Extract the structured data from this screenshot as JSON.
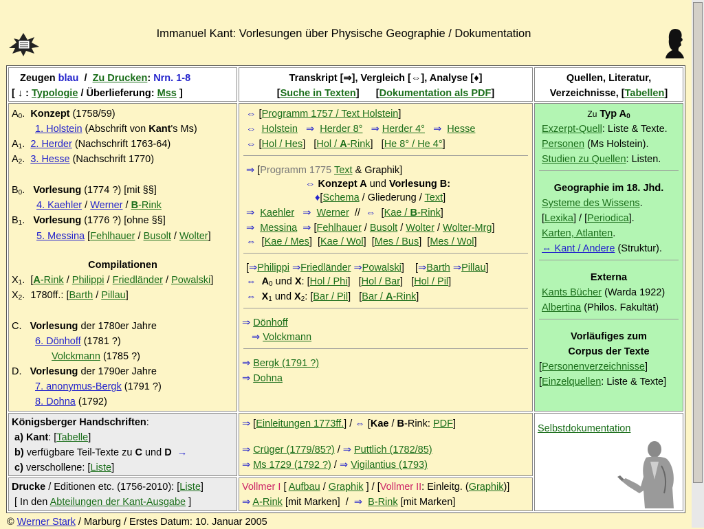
{
  "page_title": "Immanuel Kant: Vorlesungen über Physische Geographie / Dokumentation",
  "hdr": {
    "zeugen": "Zeugen",
    "blau": "blau",
    "slash": "/",
    "zu_drucken": "Zu Drucken",
    "nrn": "Nrn. 1-8",
    "typologie_pre": "[ ↓ :",
    "typologie": "Typologie",
    "ueberl": "/  Überlieferung:",
    "mss": "Mss",
    "close": "]",
    "trans_title": "Transkript [⇒], Vergleich [⇔], Analyse [♦]",
    "suche": "Suche in Texten",
    "doku_pdf": "Dokumentation als PDF",
    "quellen_title": "Quellen, Literatur,",
    "verz": "Verzeichnisse, [",
    "tabellen": "Tabellen",
    "close2": "]"
  },
  "left": {
    "a0_label": "A",
    "a0_sub": "0",
    "a0_b": "Konzept",
    "a0_t": "(1758/59)",
    "holstein": "1. Holstein",
    "holstein_t": "(Abschrift von",
    "kant": "Kant",
    "holstein_t2": "'s Ms)",
    "a1_label": "A",
    "a1_sub": "1",
    "herder": "2. Herder",
    "herder_t": "(Nachschrift 1763-64)",
    "a2_label": "A",
    "a2_sub": "2",
    "hesse": "3. Hesse",
    "hesse_t": "(Nachschrift 1770)",
    "b0_label": "B",
    "b0_sub": "0",
    "b0_b": "Vorlesung",
    "b0_t": "(1774 ?) [mit §§]",
    "kaehler": "4. Kaehler",
    "werner": "Werner",
    "brink": "B",
    "brink2": "-Rink",
    "b1_label": "B",
    "b1_sub": "1",
    "b1_b": "Vorlesung",
    "b1_t": "(1776 ?) [ohne §§]",
    "messina": "5. Messina",
    "fehlhauer": "Fehlhauer",
    "busolt": "Busolt",
    "wolter": "Wolter",
    "comp": "Compilationen",
    "x1_label": "X",
    "x1_sub": "1",
    "arink_a": "A",
    "arink": "-Rink",
    "philippi": "Philippi",
    "friedlaender": "Friedländer",
    "powalski": "Powalski",
    "x2_label": "X",
    "x2_sub": "2",
    "x2_t": "1780ff.:",
    "barth": "Barth",
    "pillau": "Pillau",
    "c_label": "C.",
    "c_b": "Vorlesung",
    "c_t": "der 1780er Jahre",
    "doenhoff": "6. Dönhoff",
    "doenhoff_t": "(1781 ?)",
    "volckmann": "Volckmann",
    "volckmann_t": "(1785 ?)",
    "d_label": "D.",
    "d_b": "Vorlesung",
    "d_t": "der 1790er Jahre",
    "bergk": "7. anonymus-Bergk",
    "bergk_t": "(1791 ?)",
    "dohna": "8. Dohna",
    "dohna_t": "(1792)"
  },
  "mid": {
    "prog1757": "Programm 1757 / Text Holstein",
    "holstein": "Holstein",
    "herder8": "Herder 8°",
    "herder4": "Herder 4°",
    "hesse": "Hesse",
    "holhes": "Hol / Hes",
    "hol_a": "Hol / ",
    "hol_a2": "A",
    "hol_a3": "-Rink",
    "he": "He  8° / He  4°",
    "prog1775": "Programm 1775",
    "text": "Text",
    "graphik_t": "& Graphik]",
    "konzept": "Konzept A",
    "und": "und",
    "vorlesung": "Vorlesung B:",
    "schema": "Schema",
    "gliederung": "/ Gliederung /",
    "text2": "Text",
    "kaehler": "Kaehler",
    "werner": "Werner",
    "kae_b": "Kae / ",
    "kae_b2": "B",
    "kae_b3": "-Rink",
    "messina": "Messina",
    "fehlhauer": "Fehlhauer",
    "busolt": "Busolt",
    "wolter": "Wolter",
    "wolter_mrg": "Wolter-Mrg",
    "kae_mes": "Kae / Mes",
    "kae_wol": "Kae / Wol",
    "mes_bus": "Mes / Bus",
    "mes_wol": "Mes / Wol",
    "philippi": "Philippi",
    "friedlaender": "Friedländer",
    "powalski": "Powalski",
    "barth": "Barth",
    "pillau": "Pillau",
    "a0x": "A",
    "a0x_sub": "0",
    "a0x_t": "und",
    "a0x_x": "X",
    "hol_phi": "Hol / Phi",
    "hol_bar": "Hol / Bar",
    "hol_pil": "Hol / Pil",
    "x1": "X",
    "x1_sub": "1",
    "x2": "X",
    "x2_sub": "2",
    "bar_pil": "Bar / Pil",
    "bar_a": "Bar / ",
    "bar_a2": "A",
    "bar_a3": "-Rink",
    "doenhoff": "Dönhoff",
    "volckmann": "Volckmann",
    "bergk": "Bergk (1791 ?)",
    "dohna": "Dohna",
    "einl": "Einleitungen 1773ff.",
    "kae": "Kae",
    "brink_b": "B",
    "brink_t": "-Rink:",
    "pdf": "PDF",
    "cruger": "Crüger (1779/85?)",
    "puttlich": "Puttlich (1782/85)",
    "ms1729": "Ms 1729 (1792 ?)",
    "vigilantius": "Vigilantius (1793)",
    "vollmer1": "Vollmer I",
    "aufbau": "Aufbau",
    "graphik": "Graphik",
    "vollmer2": "Vollmer II",
    "einleitg": "Einleitg. (",
    "graphik2": "Graphik",
    "arink_a": "A",
    "arink": "-Rink",
    "marken": "[mit Marken]",
    "brink_a": "B",
    "brink2": "-Rink",
    "marken2": "[mit Marken]"
  },
  "right": {
    "zu": "Zu",
    "typ": "Typ A",
    "typ_sub": "0",
    "exzerpt": "Exzerpt-Quell",
    "exzerpt_t": ": Liste & Texte.",
    "personen": "Personen",
    "personen_t": "(Ms Holstein).",
    "studien": "Studien zu Quellen",
    "studien_t": ": Listen.",
    "geo_title": "Geographie im 18. Jhd.",
    "systeme": "Systeme des Wissens",
    "lexika": "Lexika",
    "periodica": "Periodica",
    "karten": "Karten, Atlanten",
    "kant_andere": "⇔ Kant / Andere",
    "kant_andere_t": "(Struktur).",
    "externa": "Externa",
    "kants_buecher": "Kants Bücher",
    "warda": "(Warda 1922)",
    "albertina": "Albertina",
    "philos": "(Philos. Fakultät)",
    "vorl1": "Vorläufiges zum",
    "vorl2": "Corpus der Texte",
    "personenverz": "Personenverzeichnisse",
    "einzelquellen": "Einzelquellen",
    "einzel_t": ": Liste & Texte]",
    "selbst": "Selbstdokumentation"
  },
  "koenig": {
    "title": "Königsberger Handschriften",
    "a": "a)",
    "a_b": "Kant",
    "tabelle": "Tabelle",
    "b": "b)",
    "b_t": "verfügbare Teil-Texte zu",
    "b_c": "C",
    "und": "und",
    "b_d": "D",
    "arrow": "→",
    "c": "c)",
    "c_t": "verschollene:",
    "liste": "Liste"
  },
  "drucke": {
    "drucke": "Drucke",
    "drucke_t": "/ Editionen etc. (1756-2010): [",
    "liste": "Liste",
    "abt_pre": "[ In den",
    "abt": "Abteilungen der Kant-Ausgabe",
    "abt_post": "]"
  },
  "footer": {
    "copy": "©",
    "author": "Werner Stark",
    "marburg": "Marburg",
    "datum": "/ Erstes Datum: 10. Januar 2005"
  },
  "colors": {
    "bg": "#fdf5c6",
    "cell_yellow": "#fdf5c6",
    "cell_green": "#b3f5b3",
    "cell_gray": "#ececec",
    "link_green": "#1a6e1a",
    "link_blue": "#2222cc"
  }
}
